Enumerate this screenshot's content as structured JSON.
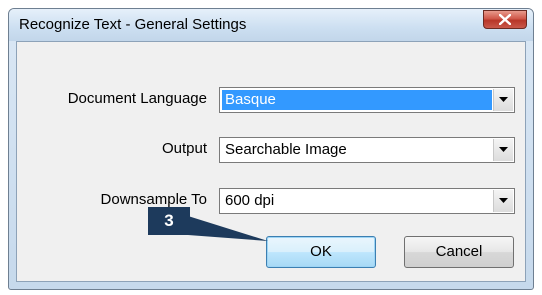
{
  "window": {
    "title": "Recognize Text - General Settings"
  },
  "form": {
    "document_language": {
      "label": "Document Language",
      "value": "Basque"
    },
    "output": {
      "label": "Output",
      "value": "Searchable Image"
    },
    "downsample": {
      "label": "Downsample To",
      "value": "600 dpi"
    }
  },
  "buttons": {
    "ok_label": "OK",
    "cancel_label": "Cancel"
  },
  "callout": {
    "step_number": "3",
    "color": "#1d3a5c"
  },
  "icons": {
    "close": "close-icon",
    "dropdown": "chevron-down-icon"
  }
}
